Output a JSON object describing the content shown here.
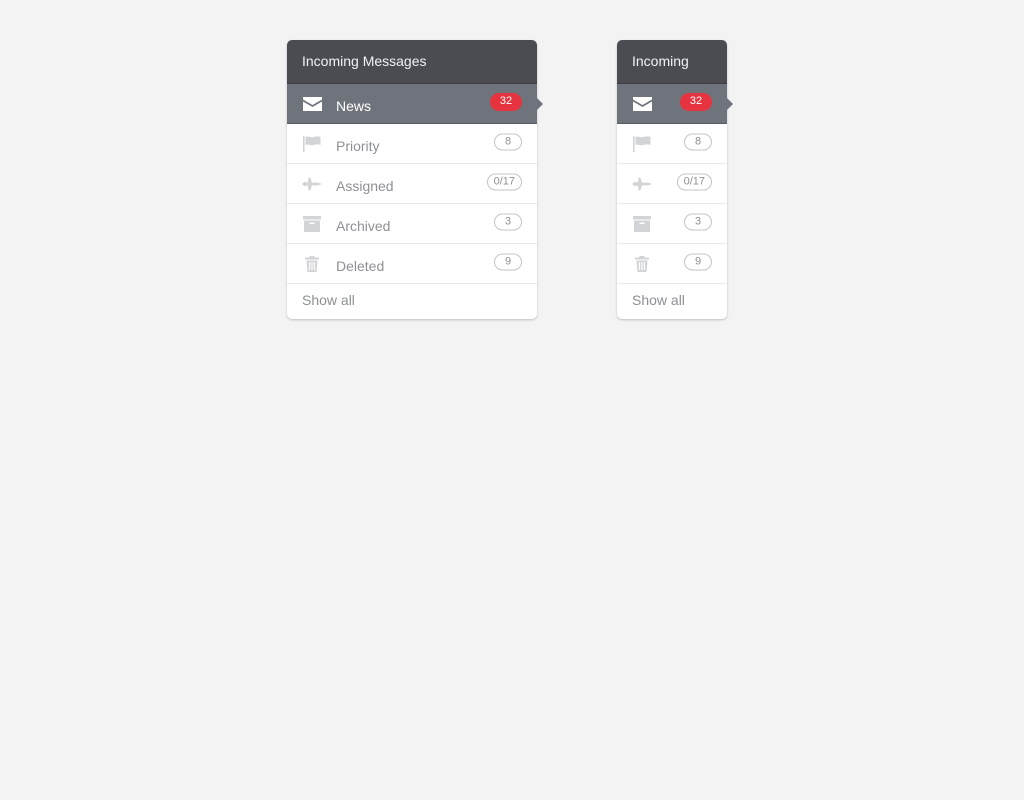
{
  "panels": [
    {
      "title": "Incoming Messages",
      "items": [
        {
          "icon": "envelope-icon",
          "label": "News",
          "count": "32",
          "active": true
        },
        {
          "icon": "flag-icon",
          "label": "Priority",
          "count": "8"
        },
        {
          "icon": "jet-icon",
          "label": "Assigned",
          "count": "0/17"
        },
        {
          "icon": "archive-box-icon",
          "label": "Archived",
          "count": "3"
        },
        {
          "icon": "trash-icon",
          "label": "Deleted",
          "count": "9"
        }
      ],
      "footer": "Show all"
    },
    {
      "title": "Incoming",
      "items": [
        {
          "icon": "envelope-icon",
          "count": "32",
          "active": true
        },
        {
          "icon": "flag-icon",
          "count": "8"
        },
        {
          "icon": "jet-icon",
          "count": "0/17"
        },
        {
          "icon": "archive-box-icon",
          "count": "3"
        },
        {
          "icon": "trash-icon",
          "count": "9"
        }
      ],
      "footer": "Show all"
    }
  ],
  "colors": {
    "header_bg": "#4a4c52",
    "active_bg": "#6f747c",
    "badge_red": "#e5343f",
    "icon_inactive": "#d3d4d7",
    "page_bg": "#f3f3f3"
  }
}
